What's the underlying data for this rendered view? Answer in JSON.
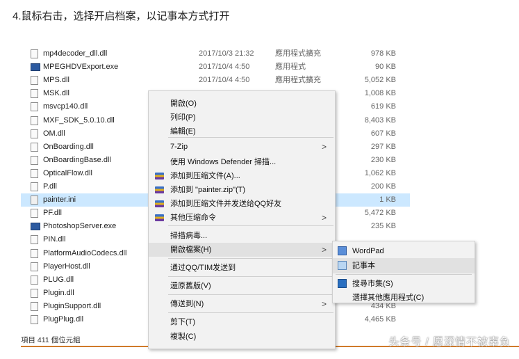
{
  "heading": "4.鼠标右击，选择开启档案，以记事本方式打开",
  "files": [
    {
      "name": "mp4decoder_dll.dll",
      "date": "2017/10/3 21:32",
      "type": "應用程式擴充",
      "size": "978 KB",
      "icon": "dll-icon"
    },
    {
      "name": "MPEGHDVExport.exe",
      "date": "2017/10/4 4:50",
      "type": "應用程式",
      "size": "90 KB",
      "icon": "exe-icon"
    },
    {
      "name": "MPS.dll",
      "date": "2017/10/4 4:50",
      "type": "應用程式擴充",
      "size": "5,052 KB",
      "icon": "dll-icon"
    },
    {
      "name": "MSK.dll",
      "date": "",
      "type": "",
      "size": "1,008 KB",
      "icon": "dll-icon"
    },
    {
      "name": "msvcp140.dll",
      "date": "",
      "type": "",
      "size": "619 KB",
      "icon": "dll-icon"
    },
    {
      "name": "MXF_SDK_5.0.10.dll",
      "date": "",
      "type": "",
      "size": "8,403 KB",
      "icon": "dll-icon"
    },
    {
      "name": "OM.dll",
      "date": "",
      "type": "",
      "size": "607 KB",
      "icon": "dll-icon"
    },
    {
      "name": "OnBoarding.dll",
      "date": "",
      "type": "",
      "size": "297 KB",
      "icon": "dll-icon"
    },
    {
      "name": "OnBoardingBase.dll",
      "date": "",
      "type": "",
      "size": "230 KB",
      "icon": "dll-icon"
    },
    {
      "name": "OpticalFlow.dll",
      "date": "",
      "type": "",
      "size": "1,062 KB",
      "icon": "dll-icon"
    },
    {
      "name": "P.dll",
      "date": "",
      "type": "",
      "size": "200 KB",
      "icon": "dll-icon"
    },
    {
      "name": "painter.ini",
      "date": "",
      "type": "",
      "size": "1 KB",
      "icon": "ini-icon",
      "selected": true
    },
    {
      "name": "PF.dll",
      "date": "",
      "type": "",
      "size": "5,472 KB",
      "icon": "dll-icon"
    },
    {
      "name": "PhotoshopServer.exe",
      "date": "",
      "type": "",
      "size": "235 KB",
      "icon": "exe-icon"
    },
    {
      "name": "PIN.dll",
      "date": "",
      "type": "",
      "size": "",
      "icon": "dll-icon"
    },
    {
      "name": "PlatformAudioCodecs.dll",
      "date": "",
      "type": "",
      "size": "",
      "icon": "dll-icon"
    },
    {
      "name": "PlayerHost.dll",
      "date": "",
      "type": "",
      "size": "",
      "icon": "dll-icon"
    },
    {
      "name": "PLUG.dll",
      "date": "",
      "type": "",
      "size": "",
      "icon": "dll-icon"
    },
    {
      "name": "Plugin.dll",
      "date": "",
      "type": "",
      "size": "",
      "icon": "dll-icon"
    },
    {
      "name": "PluginSupport.dll",
      "date": "",
      "type": "",
      "size": "434 KB",
      "icon": "dll-icon"
    },
    {
      "name": "PlugPlug.dll",
      "date": "",
      "type": "",
      "size": "4,465 KB",
      "icon": "dll-icon"
    }
  ],
  "status": "項目 411 個位元組",
  "watermark": "头条号 / 愿深情不被辜负",
  "context_menu": [
    {
      "label": "開啟(O)"
    },
    {
      "label": "列印(P)"
    },
    {
      "label": "編輯(E)"
    },
    {
      "label": "7-Zip",
      "submenu": true
    },
    {
      "label": "使用 Windows Defender 掃描..."
    },
    {
      "label": "添加到压缩文件(A)...",
      "icon": "winrar-icon"
    },
    {
      "label": "添加到 \"painter.zip\"(T)",
      "icon": "winrar-icon"
    },
    {
      "label": "添加到压缩文件并发送给QQ好友",
      "icon": "winrar-icon"
    },
    {
      "label": "其他压缩命令",
      "icon": "winrar-icon",
      "submenu": true
    },
    {
      "label": "掃描病毒..."
    },
    {
      "label": "開啟檔案(H)",
      "submenu": true,
      "highlighted": true
    },
    {
      "label": "通过QQ/TIM发送到"
    },
    {
      "label": "還原舊版(V)"
    },
    {
      "label": "傳送到(N)",
      "submenu": true
    },
    {
      "label": "剪下(T)"
    },
    {
      "label": "複製(C)"
    }
  ],
  "open_with_menu": [
    {
      "label": "WordPad",
      "icon": "wordpad-icon"
    },
    {
      "label": "記事本",
      "icon": "notepad-icon",
      "highlighted": true
    },
    {
      "label": "搜尋市集(S)",
      "icon": "store-icon"
    },
    {
      "label": "選擇其他應用程式(C)"
    }
  ],
  "arrow_glyph": ">"
}
